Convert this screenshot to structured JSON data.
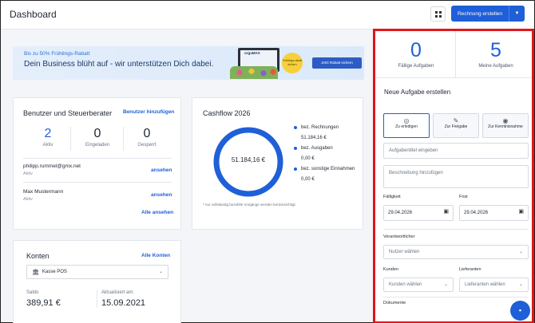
{
  "header": {
    "title": "Dashboard",
    "primary_button": "Rechnung erstellen"
  },
  "banner": {
    "promo_small": "Bis zu 50% Frühlings-Rabatt",
    "promo_big": "Dein Business blüht auf - wir unterstützen Dich dabei.",
    "product_label": "orgaMAX",
    "badge_text": "Frühlings-rabatt sichern",
    "cta": "Jetzt Rabatt sichern"
  },
  "users_card": {
    "title": "Benutzer und Steuerberater",
    "add_link": "Benutzer hinzufügen",
    "stats": [
      {
        "value": "2",
        "label": "Aktiv"
      },
      {
        "value": "0",
        "label": "Eingeladen"
      },
      {
        "value": "0",
        "label": "Gesperrt"
      }
    ],
    "users": [
      {
        "name": "philipp.rummel@gmx.net",
        "role": "Aktiv",
        "link": "ansehen"
      },
      {
        "name": "Max Mustermann",
        "role": "Aktiv",
        "link": "ansehen"
      }
    ],
    "all_link": "Alle ansehen"
  },
  "cashflow": {
    "title": "Cashflow 2026",
    "center_value": "51.184,16 €",
    "legend": [
      {
        "label": "bez. Rechnungen",
        "value": "51.184,16 €"
      },
      {
        "label": "bez. Ausgaben",
        "value": "0,00 €"
      },
      {
        "label": "bez. sonstige Einnahmen",
        "value": "0,00 €"
      }
    ],
    "note": "* nur vollständig bezahlte Vorgänge werden berücksichtigt.",
    "ring_color": "#1f5fd8",
    "paid_fraction": 1.0
  },
  "konten": {
    "title": "Konten",
    "all_link": "Alle Konten",
    "selected_account": "Kasse POS",
    "saldo_label": "Saldo",
    "saldo_value": "389,91 €",
    "updated_label": "Aktualisiert am:",
    "updated_value": "15.09.2021"
  },
  "tasks_panel": {
    "due_count": "0",
    "due_label": "Fällige Aufgaben",
    "mine_count": "5",
    "mine_label": "Meine Aufgaben",
    "create_title": "Neue Aufgabe erstellen",
    "types": [
      {
        "label": "Zu erledigen",
        "icon": "check-circle-icon"
      },
      {
        "label": "Zur Freigabe",
        "icon": "edit-icon"
      },
      {
        "label": "Zur Kenntnisnahme",
        "icon": "eye-icon"
      }
    ],
    "title_placeholder": "Aufgabentitel eingeben",
    "desc_placeholder": "Beschreibung hinzufügen",
    "faelligkeit_label": "Fälligkeit",
    "faelligkeit_value": "29.04.2026",
    "frist_label": "Frist",
    "frist_value": "29.04.2026",
    "verantwortlicher_label": "Verantwortlicher",
    "nutzer_placeholder": "Nutzer wählen",
    "kunden_label": "Kunden",
    "kunden_placeholder": "Kunden wählen",
    "lieferanten_label": "Lieferanten",
    "lieferanten_placeholder": "Lieferanten wählen",
    "dokumente_label": "Dokumente"
  },
  "colors": {
    "accent": "#1f5fd8",
    "highlight": "#e0161b"
  }
}
